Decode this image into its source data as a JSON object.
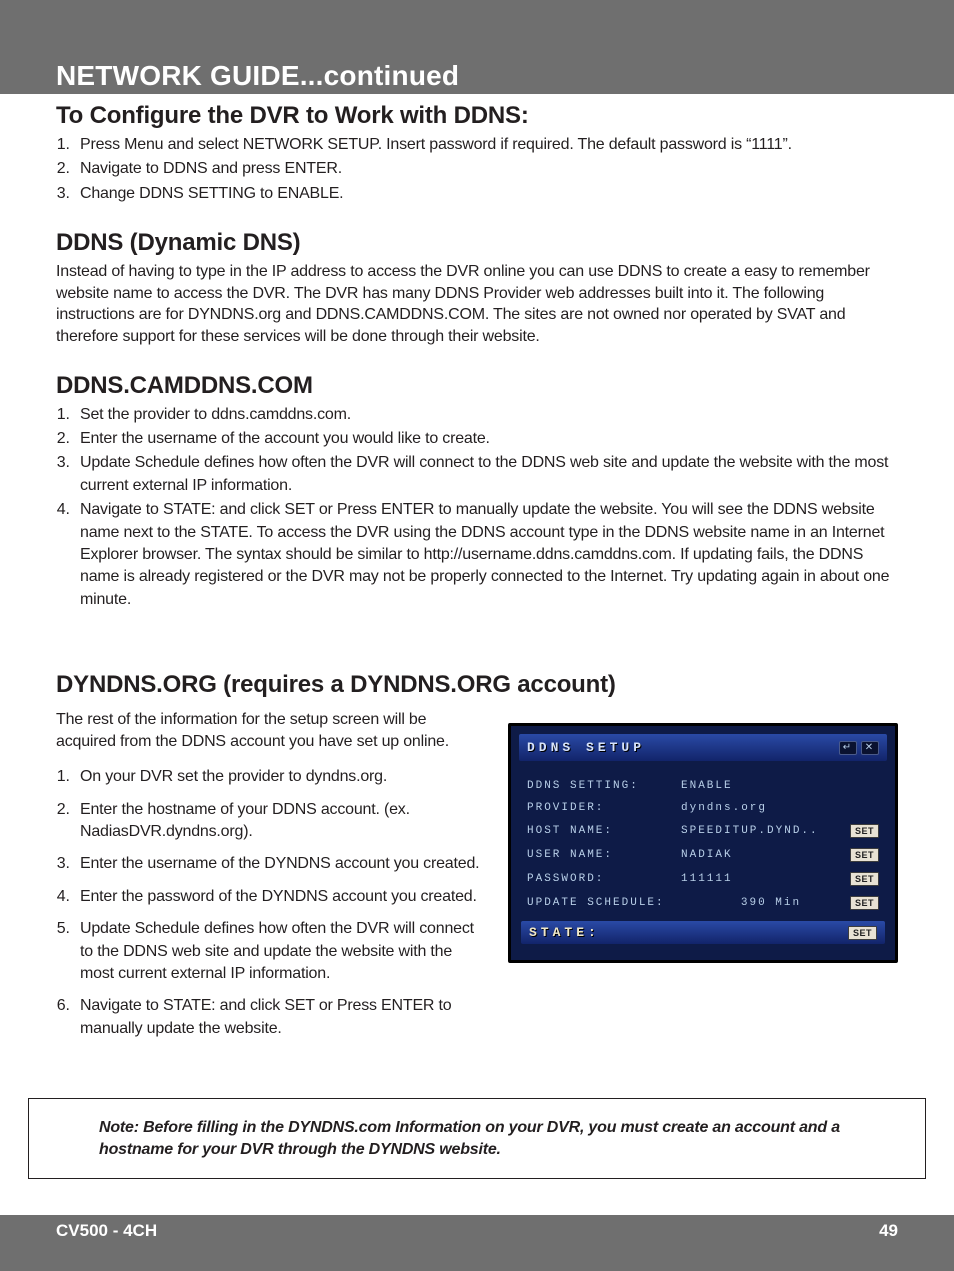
{
  "section_title": "NETWORK GUIDE...continued",
  "h_configure": "To Configure the DVR to Work with DDNS:",
  "configure_steps": [
    "Press Menu and select NETWORK SETUP. Insert password if required. The default password is “1111”.",
    "Navigate to DDNS and press ENTER.",
    "Change DDNS SETTING to ENABLE."
  ],
  "h_ddns": "DDNS (Dynamic DNS)",
  "ddns_para": "Instead of having to type in the IP address to access the DVR online you can use DDNS to create a easy to remember website name to access the DVR. The DVR has many DDNS Provider web addresses built into it. The following instructions are for DYNDNS.org and DDNS.CAMDDNS.COM. The sites are not owned nor operated by SVAT and therefore support for these services will be done through their website.",
  "h_camddns": "DDNS.CAMDDNS.COM",
  "camddns_steps": [
    "Set the provider to ddns.camddns.com.",
    "Enter the username of the account you would like to create.",
    "Update Schedule defines how often the DVR will connect to the DDNS web site and update the website with the most current external IP information.",
    "Navigate to STATE: and click SET or Press ENTER to manually update the website. You will see the DDNS website name next to the STATE. To access the DVR using the DDNS account type in the DDNS website name in an Internet Explorer browser. The syntax should be similar to http://username.ddns.camddns.com. If updating fails, the DDNS name is already registered or the DVR may not be properly connected to the Internet. Try updating again in about one minute."
  ],
  "h_dyndns": "DYNDNS.ORG (requires a DYNDNS.ORG account)",
  "dyndns_para": "The rest of the information for the setup screen will be acquired from the DDNS account you have set up online.",
  "dyndns_steps": [
    "On your DVR set the provider to dyndns.org.",
    "Enter the hostname of your DDNS account. (ex. NadiasDVR.dyndns.org).",
    "Enter the username of the DYNDNS account you created.",
    "Enter the password of the DYNDNS account you created.",
    "Update Schedule defines how often the DVR will connect to the DDNS web site and update the website with the most current external IP information.",
    "Navigate to STATE: and click SET or Press ENTER to manually update the website."
  ],
  "dvr": {
    "title": "DDNS SETUP",
    "rows": {
      "setting": {
        "label": "DDNS SETTING:",
        "val": "ENABLE"
      },
      "provider": {
        "label": "PROVIDER:",
        "val": "dyndns.org"
      },
      "host": {
        "label": "HOST NAME:",
        "val": "SPEEDITUP.DYND..",
        "set": "SET"
      },
      "user": {
        "label": "USER NAME:",
        "val": "NADIAK",
        "set": "SET"
      },
      "pass": {
        "label": "PASSWORD:",
        "val": "111111",
        "set": "SET"
      },
      "update": {
        "label": "UPDATE SCHEDULE:",
        "val": "390 Min",
        "set": "SET"
      }
    },
    "state": {
      "label": "STATE:",
      "set": "SET"
    }
  },
  "note": "Note: Before filling in the DYNDNS.com Information on your DVR, you must create an account and a hostname for your DVR through the DYNDNS website.",
  "footer": {
    "model": "CV500 - 4CH",
    "page": "49"
  }
}
